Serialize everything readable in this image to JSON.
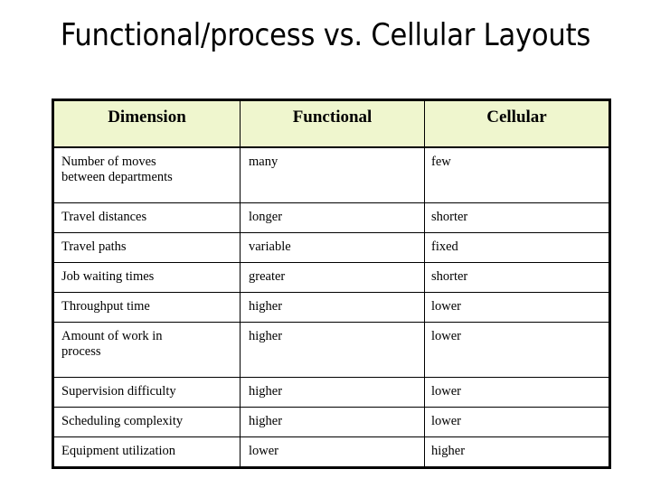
{
  "slide": {
    "title": "Functional/process vs. Cellular Layouts",
    "background_color": "#FFFFFF",
    "text_color": "#000000"
  },
  "table": {
    "header_background_color": "#EFF6CE",
    "border_color": "#000000",
    "columns": [
      {
        "key": "dimension",
        "label": "Dimension"
      },
      {
        "key": "functional",
        "label": "Functional"
      },
      {
        "key": "cellular",
        "label": "Cellular"
      }
    ],
    "rows": [
      {
        "dimension": "Number of moves between departments",
        "dimension_line1": "Number of moves",
        "dimension_line2": "between departments",
        "functional": "many",
        "cellular": "few",
        "wrapped": true
      },
      {
        "dimension": "Travel distances",
        "dimension_line1": "Travel distances",
        "dimension_line2": "",
        "functional": "longer",
        "cellular": "shorter",
        "wrapped": false
      },
      {
        "dimension": "Travel paths",
        "dimension_line1": "Travel paths",
        "dimension_line2": "",
        "functional": "variable",
        "cellular": "fixed",
        "wrapped": false
      },
      {
        "dimension": "Job waiting times",
        "dimension_line1": "Job waiting times",
        "dimension_line2": "",
        "functional": "greater",
        "cellular": "shorter",
        "wrapped": false
      },
      {
        "dimension": "Throughput time",
        "dimension_line1": "Throughput time",
        "dimension_line2": "",
        "functional": "higher",
        "cellular": "lower",
        "wrapped": false
      },
      {
        "dimension": "Amount of work in process",
        "dimension_line1": "Amount of work in",
        "dimension_line2": "process",
        "functional": "higher",
        "cellular": "lower",
        "wrapped": true
      },
      {
        "dimension": "Supervision difficulty",
        "dimension_line1": "Supervision difficulty",
        "dimension_line2": "",
        "functional": "higher",
        "cellular": "lower",
        "wrapped": false
      },
      {
        "dimension": "Scheduling complexity",
        "dimension_line1": "Scheduling complexity",
        "dimension_line2": "",
        "functional": "higher",
        "cellular": "lower",
        "wrapped": false
      },
      {
        "dimension": "Equipment utilization",
        "dimension_line1": "Equipment utilization",
        "dimension_line2": "",
        "functional": "lower",
        "cellular": "higher",
        "wrapped": false
      }
    ]
  }
}
